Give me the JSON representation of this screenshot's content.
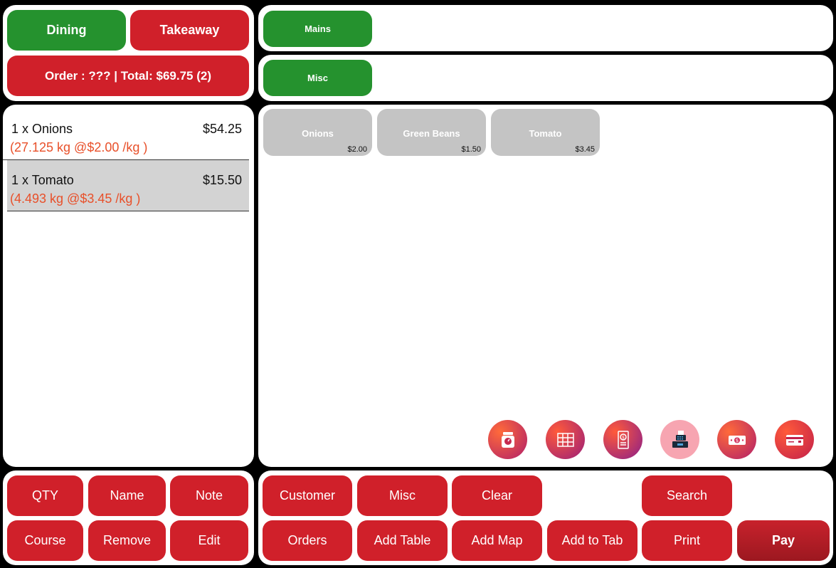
{
  "order_type": {
    "dining": "Dining",
    "takeaway": "Takeaway"
  },
  "order_summary": "Order : ??? | Total: $69.75 (2)",
  "categories": {
    "mains": "Mains",
    "misc": "Misc"
  },
  "order_items": [
    {
      "name": "1 x Onions",
      "price": "$54.25",
      "detail": "(27.125 kg @$2.00 /kg )",
      "selected": false
    },
    {
      "name": "1 x Tomato",
      "price": "$15.50",
      "detail": "(4.493 kg @$3.45 /kg )",
      "selected": true
    }
  ],
  "products": [
    {
      "name": "Onions",
      "price": "$2.00"
    },
    {
      "name": "Green Beans",
      "price": "$1.50"
    },
    {
      "name": "Tomato",
      "price": "$3.45"
    }
  ],
  "quick_icons": [
    "scale-icon",
    "table-grid-icon",
    "receipt-dollar-icon",
    "cash-register-icon",
    "banknote-icon",
    "credit-card-icon"
  ],
  "left_actions": {
    "qty": "QTY",
    "name": "Name",
    "note": "Note",
    "course": "Course",
    "remove": "Remove",
    "edit": "Edit"
  },
  "right_actions": {
    "customer": "Customer",
    "misc": "Misc",
    "clear": "Clear",
    "search": "Search",
    "orders": "Orders",
    "add_table": "Add Table",
    "add_map": "Add Map",
    "add_to_tab": "Add to Tab",
    "print": "Print",
    "pay": "Pay"
  },
  "colors": {
    "green": "#25922e",
    "red": "#d0202a",
    "tile_gray": "#c4c4c4",
    "detail_orange": "#e8502a",
    "pay_dark_red": "#b51c24"
  }
}
